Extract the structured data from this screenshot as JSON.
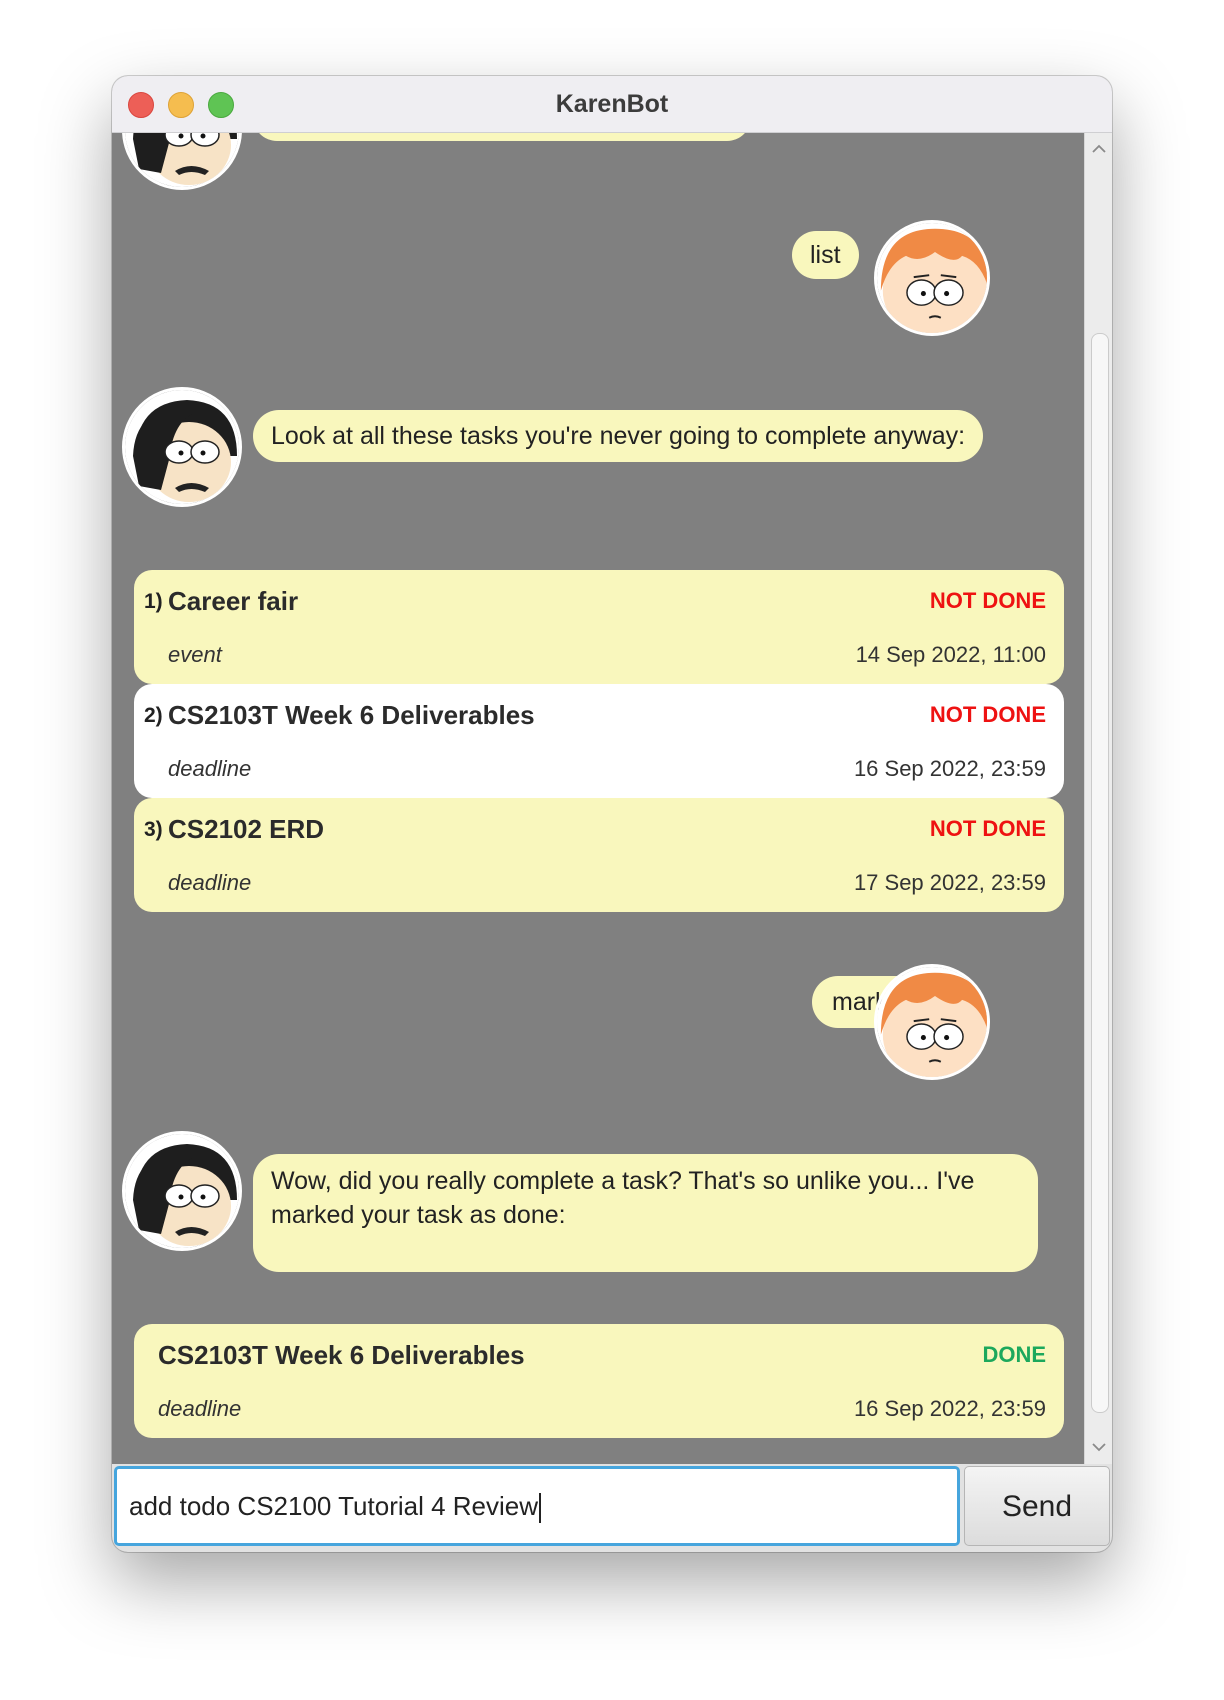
{
  "window": {
    "title": "KarenBot"
  },
  "messages": {
    "user_list": "list",
    "bot_list_intro": "Look at all these tasks you're never going to complete anyway:",
    "user_mark": "mark 2",
    "bot_mark_reply": "Wow, did you really complete a task? That's so unlike you... I've marked your task as done:"
  },
  "tasks": [
    {
      "num": "1)",
      "name": "Career fair",
      "status": "NOT DONE",
      "type": "event",
      "date": "14 Sep 2022, 11:00"
    },
    {
      "num": "2)",
      "name": "CS2103T Week 6 Deliverables",
      "status": "NOT DONE",
      "type": "deadline",
      "date": "16 Sep 2022, 23:59"
    },
    {
      "num": "3)",
      "name": "CS2102 ERD",
      "status": "NOT DONE",
      "type": "deadline",
      "date": "17 Sep 2022, 23:59"
    }
  ],
  "marked_task": {
    "name": "CS2103T Week 6 Deliverables",
    "status": "DONE",
    "type": "deadline",
    "date": "16 Sep 2022, 23:59"
  },
  "input": {
    "value": "add todo CS2100 Tutorial 4 Review"
  },
  "send_label": "Send",
  "colors": {
    "bubble": "#f9f7bd",
    "chat_background": "#808080",
    "not_done": "#ee1212",
    "done": "#1ca85c",
    "focus_ring": "#46a5dd"
  },
  "icons": {
    "bot_avatar": "cartoon-man-black-hair-icon",
    "user_avatar": "cartoon-boy-orange-hair-icon"
  }
}
